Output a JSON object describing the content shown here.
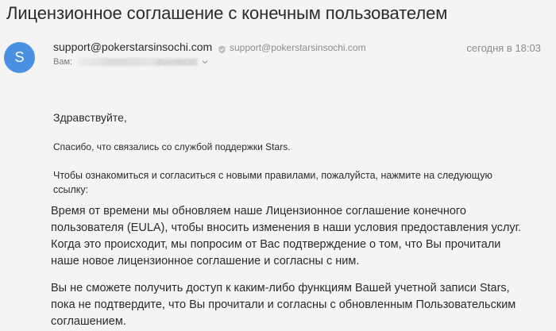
{
  "email": {
    "subject": "Лицензионное соглашение с конечным пользователем",
    "avatar_letter": "S",
    "sender_name": "support@pokerstarsinsochi.com",
    "sender_email": "support@pokerstarsinsochi.com",
    "date": "сегодня в 18:03",
    "recipient_label": "Вам:",
    "recipient_visible_fragment": "@yandex.ru",
    "icons": {
      "verified": "verified-badge-icon",
      "expand": "chevron-down-icon"
    },
    "colors": {
      "avatar_bg": "#4a90e2",
      "background": "#f4f4f4",
      "muted_text": "#8c8c8c"
    }
  },
  "body": {
    "greeting": "Здравствуйте,",
    "thanks": "Спасибо, что связались со службой поддержки Stars.",
    "instructions": "Чтобы ознакомиться и согласиться с новыми правилами, пожалуйста, нажмите на следующую ссылку:",
    "paragraph1": "Время от времени мы обновляем наше Лицензионное соглашение конечного пользователя (EULA), чтобы вносить изменения в наши условия предоставления услуг. Когда это происходит, мы попросим от Вас подтверждение о том, что Вы прочитали наше новое лицензионное соглашение и согласны с ним.",
    "paragraph2": "Вы не сможете получить доступ к каким-либо функциям Вашей учетной записи Stars, пока не подтвердите, что Вы прочитали и согласны с обновленным Пользовательским соглашением."
  }
}
